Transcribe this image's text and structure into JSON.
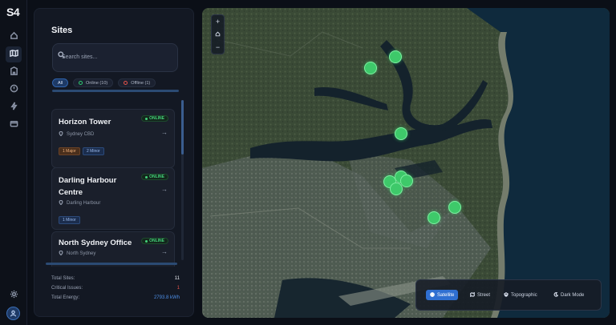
{
  "app": {
    "logo": "S4"
  },
  "rail": {
    "items": [
      {
        "icon": "home-icon"
      },
      {
        "icon": "map-icon",
        "active": true
      },
      {
        "icon": "building-icon"
      },
      {
        "icon": "alert-icon"
      },
      {
        "icon": "lightning-icon"
      },
      {
        "icon": "billing-card-icon"
      }
    ],
    "settings_icon": "gear-icon",
    "user_icon": "user-icon"
  },
  "sites_panel": {
    "title": "Sites",
    "search": {
      "placeholder": "Search sites..."
    },
    "filters": {
      "all": "All",
      "online": "Online (10)",
      "offline": "Offline (1)"
    },
    "sites": [
      {
        "name": "Horizon Tower",
        "status": "ONLINE",
        "location": "Sydney CBD",
        "tags": [
          "1 Major",
          "2 Minor"
        ]
      },
      {
        "name": "Darling Harbour Centre",
        "status": "ONLINE",
        "location": "Darling Harbour",
        "tags": [
          "1 Minor"
        ]
      },
      {
        "name": "North Sydney Office",
        "status": "ONLINE",
        "location": "North Sydney",
        "tags": []
      }
    ],
    "stats": {
      "total_sites_label": "Total Sites:",
      "total_sites": "11",
      "critical_label": "Critical Issues:",
      "critical": "1",
      "energy_label": "Total Energy:",
      "energy": "2793.8 kWh"
    }
  },
  "map": {
    "zoom_in": "+",
    "zoom_out": "−",
    "layers": {
      "satellite": "Satellite",
      "street": "Street",
      "topographic": "Topographic",
      "dark": "Dark Mode",
      "active": "satellite"
    },
    "colors": {
      "marker": "#3ec96a",
      "active_layer": "#2f6fd1"
    }
  }
}
